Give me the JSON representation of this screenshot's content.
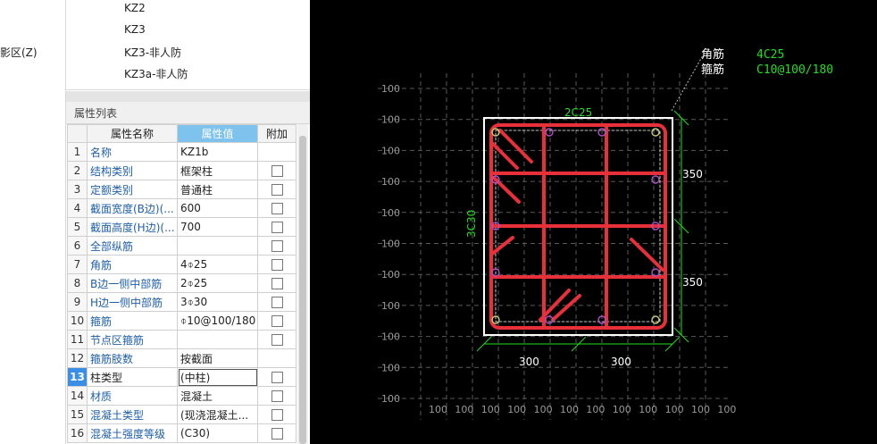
{
  "left_menu": {
    "text": "阴影区(Z)"
  },
  "component_list": {
    "items": [
      "KZ2",
      "KZ3",
      "KZ3-非人防",
      "KZ3a-非人防"
    ]
  },
  "property_panel": {
    "title": "属性列表",
    "columns": {
      "name": "属性名称",
      "value": "属性值",
      "extra": "附加"
    },
    "rows": [
      {
        "no": "1",
        "name": "名称",
        "value": "KZ1b",
        "checkbox": false
      },
      {
        "no": "2",
        "name": "结构类别",
        "value": "框架柱",
        "checkbox": true
      },
      {
        "no": "3",
        "name": "定额类别",
        "value": "普通柱",
        "checkbox": true
      },
      {
        "no": "4",
        "name": "截面宽度(B边)(...",
        "value": "600",
        "checkbox": true
      },
      {
        "no": "5",
        "name": "截面高度(H边)(...",
        "value": "700",
        "checkbox": true
      },
      {
        "no": "6",
        "name": "全部纵筋",
        "value": "",
        "checkbox": true
      },
      {
        "no": "7",
        "name": "角筋",
        "value": "4⌽25",
        "checkbox": true
      },
      {
        "no": "8",
        "name": "B边一侧中部筋",
        "value": "2⌽25",
        "checkbox": true
      },
      {
        "no": "9",
        "name": "H边一侧中部筋",
        "value": "3⌽30",
        "checkbox": true
      },
      {
        "no": "10",
        "name": "箍筋",
        "value": "⌽10@100/180",
        "checkbox": true
      },
      {
        "no": "11",
        "name": "节点区箍筋",
        "value": "",
        "checkbox": true
      },
      {
        "no": "12",
        "name": "箍筋肢数",
        "value": "按截面",
        "checkbox": false
      },
      {
        "no": "13",
        "name": "柱类型",
        "value": "(中柱)",
        "checkbox": true,
        "selected": true
      },
      {
        "no": "14",
        "name": "材质",
        "value": "混凝土",
        "checkbox": true
      },
      {
        "no": "15",
        "name": "混凝土类型",
        "value": "(现浇混凝土...",
        "checkbox": true
      },
      {
        "no": "16",
        "name": "混凝土强度等级",
        "value": "(C30)",
        "checkbox": true
      }
    ]
  },
  "cad_drawing": {
    "grid_label": "100",
    "top_rebar_label": "2C25",
    "side_rebar_label": "3C30",
    "corner_label": "角筋",
    "corner_value": "4C25",
    "stirrup_label": "箍筋",
    "stirrup_value": "C10@100/180",
    "dim_h_upper": "350",
    "dim_h_lower": "350",
    "dim_b_left": "300",
    "dim_b_right": "300",
    "colors": {
      "background": "#000000",
      "rebar": "#e8303a",
      "dimension": "#22dd22",
      "annotation_text": "#22dd22",
      "outline": "#ffffff",
      "grid": "#6a6a6a"
    }
  }
}
